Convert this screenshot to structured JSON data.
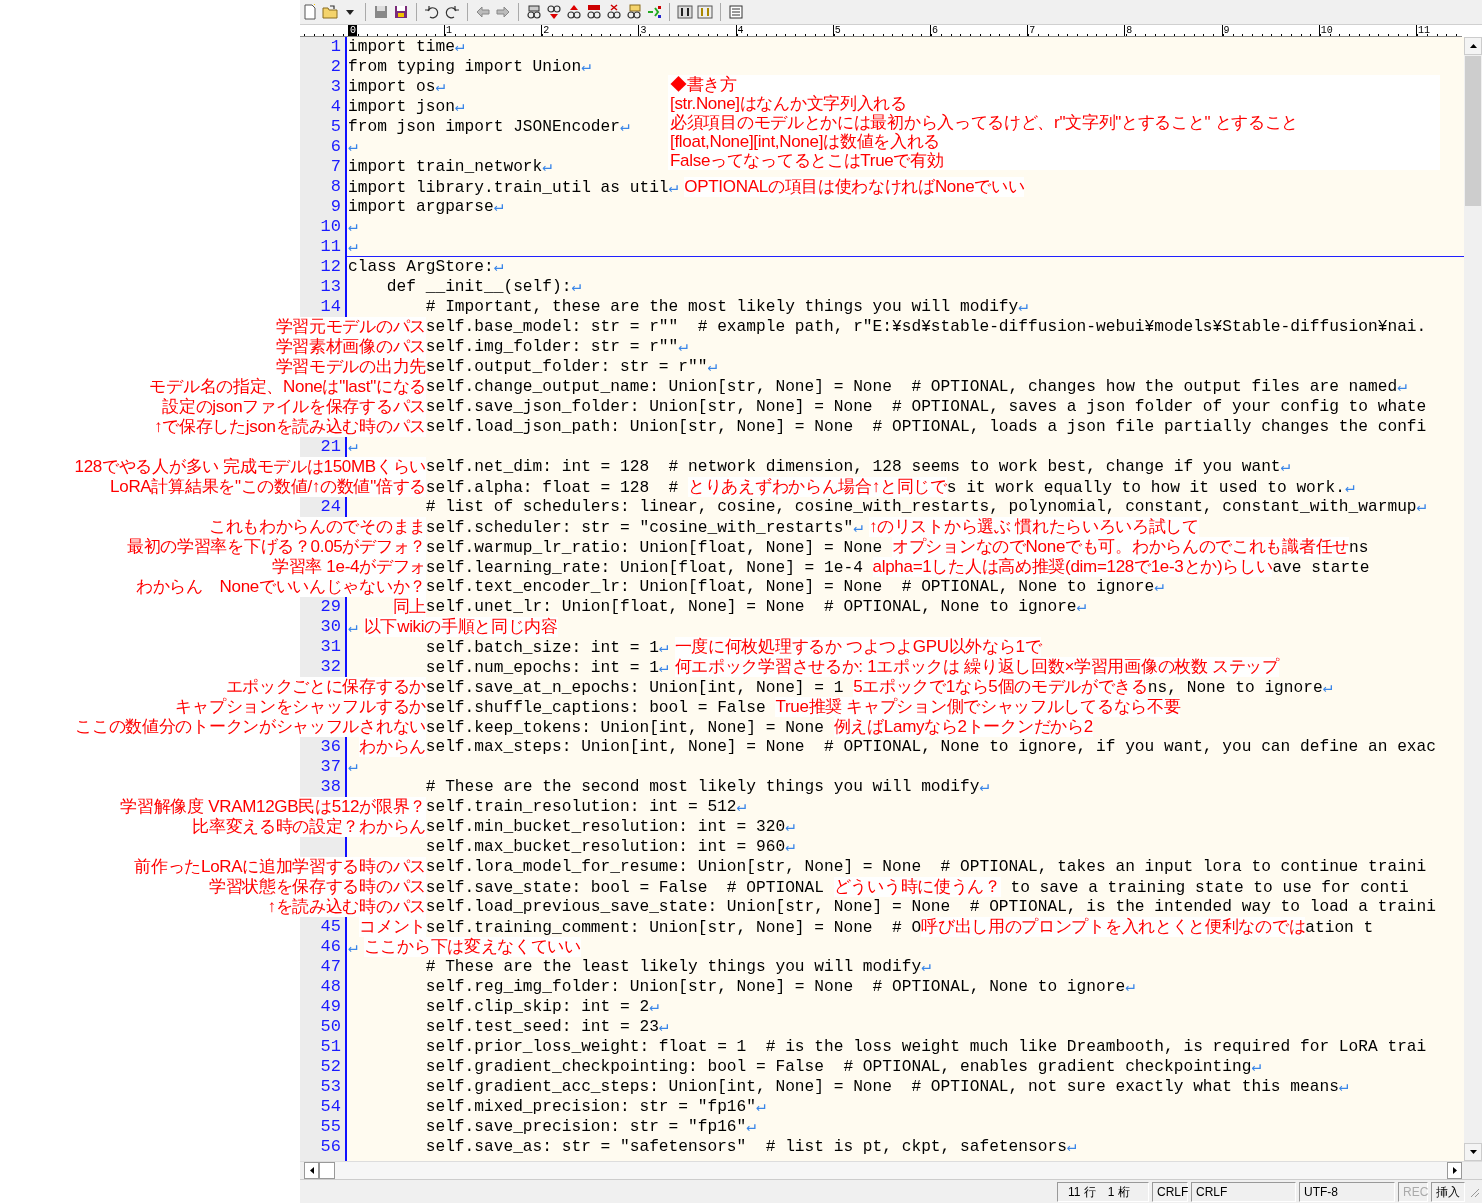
{
  "ruler": [
    {
      "label": "0",
      "current": true
    },
    {
      "label": "1",
      "current": false
    },
    {
      "label": "2",
      "current": false
    },
    {
      "label": "3",
      "current": false
    },
    {
      "label": "4",
      "current": false
    },
    {
      "label": "5",
      "current": false
    },
    {
      "label": "6",
      "current": false
    },
    {
      "label": "7",
      "current": false
    },
    {
      "label": "8",
      "current": false
    },
    {
      "label": "9",
      "current": false
    },
    {
      "label": "10",
      "current": false
    },
    {
      "label": "11",
      "current": false
    }
  ],
  "top_note": [
    "◆書き方",
    "[str.None]はなんか文字列入れる",
    "必須項目のモデルとかには最初から入ってるけど、r\"文字列\"とすること\" とすること",
    "[float,None][int,None]は数値を入れる",
    "FalseってなってるとこはTrueで有効"
  ],
  "rows": [
    {
      "num": "1",
      "current": false,
      "code": [
        {
          "kind": "code",
          "text": "import time"
        },
        {
          "kind": "eol",
          "text": "↵"
        }
      ]
    },
    {
      "num": "2",
      "current": false,
      "code": [
        {
          "kind": "code",
          "text": "from typing import Union"
        },
        {
          "kind": "eol",
          "text": "↵"
        }
      ]
    },
    {
      "num": "3",
      "current": false,
      "code": [
        {
          "kind": "code",
          "text": "import os"
        },
        {
          "kind": "eol",
          "text": "↵"
        }
      ]
    },
    {
      "num": "4",
      "current": false,
      "code": [
        {
          "kind": "code",
          "text": "import json"
        },
        {
          "kind": "eol",
          "text": "↵"
        }
      ]
    },
    {
      "num": "5",
      "current": false,
      "code": [
        {
          "kind": "code",
          "text": "from json import JSONEncoder"
        },
        {
          "kind": "eol",
          "text": "↵"
        }
      ]
    },
    {
      "num": "6",
      "current": false,
      "code": [
        {
          "kind": "eol",
          "text": "↵"
        }
      ]
    },
    {
      "num": "7",
      "current": false,
      "code": [
        {
          "kind": "code",
          "text": "import train_network"
        },
        {
          "kind": "eol",
          "text": "↵"
        }
      ]
    },
    {
      "num": "8",
      "current": false,
      "code": [
        {
          "kind": "code",
          "text": "import library.train_util as util"
        },
        {
          "kind": "eol",
          "text": "↵"
        },
        {
          "kind": "note",
          "text": "OPTIONALの項目は使わなければNoneでいい"
        }
      ]
    },
    {
      "num": "9",
      "current": false,
      "code": [
        {
          "kind": "code",
          "text": "import argparse"
        },
        {
          "kind": "eol",
          "text": "↵"
        }
      ]
    },
    {
      "num": "10",
      "current": false,
      "code": [
        {
          "kind": "eol",
          "text": "↵"
        }
      ]
    },
    {
      "num": "11",
      "current": true,
      "code": [
        {
          "kind": "eol",
          "text": "↵"
        }
      ]
    },
    {
      "num": "12",
      "current": false,
      "code": [
        {
          "kind": "code",
          "text": "class ArgStore:"
        },
        {
          "kind": "eol",
          "text": "↵"
        }
      ]
    },
    {
      "num": "13",
      "current": false,
      "code": [
        {
          "kind": "code",
          "text": "    def __init__(self):"
        },
        {
          "kind": "eol",
          "text": "↵"
        }
      ]
    },
    {
      "num": "14",
      "current": false,
      "code": [
        {
          "kind": "code",
          "text": "        # Important, these are the most likely things you will modify"
        },
        {
          "kind": "eol",
          "text": "↵"
        }
      ]
    },
    {
      "note_left": "学習元モデルのパス",
      "current": false,
      "code": [
        {
          "kind": "code",
          "text": "        self.base_model: str = r\"\"  # example path, r\"E:¥sd¥stable-diffusion-webui¥models¥Stable-diffusion¥nai."
        }
      ]
    },
    {
      "note_left": "学習素材画像のパス",
      "current": false,
      "code": [
        {
          "kind": "code",
          "text": "        self.img_folder: str = r\"\""
        },
        {
          "kind": "eol",
          "text": "↵"
        }
      ]
    },
    {
      "note_left": "学習モデルの出力先",
      "current": false,
      "code": [
        {
          "kind": "code",
          "text": "        self.output_folder: str = r\"\""
        },
        {
          "kind": "eol",
          "text": "↵"
        }
      ]
    },
    {
      "note_left": "モデル名の指定、Noneは\"last\"になる",
      "current": false,
      "code": [
        {
          "kind": "code",
          "text": "        self.change_output_name: Union[str, None] = None  # OPTIONAL, changes how the output files are named"
        },
        {
          "kind": "eol",
          "text": "↵"
        }
      ]
    },
    {
      "note_left": "設定のjsonファイルを保存するパス",
      "current": false,
      "code": [
        {
          "kind": "code",
          "text": "        self.save_json_folder: Union[str, None] = None  # OPTIONAL, saves a json folder of your config to whate"
        }
      ]
    },
    {
      "note_left": "↑で保存したjsonを読み込む時のパス",
      "current": false,
      "code": [
        {
          "kind": "code",
          "text": "        self.load_json_path: Union[str, None] = None  # OPTIONAL, loads a json file partially changes the confi"
        }
      ]
    },
    {
      "num": "21",
      "current": false,
      "code": [
        {
          "kind": "eol",
          "text": "↵"
        }
      ]
    },
    {
      "note_left": "128でやる人が多い 完成モデルは150MBくらい",
      "current": false,
      "code": [
        {
          "kind": "code",
          "text": "        self.net_dim: int = 128  # network dimension, 128 seems to work best, change if you want"
        },
        {
          "kind": "eol",
          "text": "↵"
        }
      ]
    },
    {
      "note_left": "LoRA計算結果を\"この数値/↑の数値\"倍する",
      "current": false,
      "code": [
        {
          "kind": "code",
          "text": "        self.alpha: float = 128  # "
        },
        {
          "kind": "note",
          "text": "とりあえずわからん場合↑と同じで"
        },
        {
          "kind": "code",
          "text": "s it work equally to how it used to work."
        },
        {
          "kind": "eol",
          "text": "↵"
        }
      ]
    },
    {
      "num": "24",
      "current": false,
      "code": [
        {
          "kind": "code",
          "text": "        # list of schedulers: linear, cosine, cosine_with_restarts, polynomial, constant, constant_with_warmup"
        },
        {
          "kind": "eol",
          "text": "↵"
        }
      ]
    },
    {
      "note_left": "これもわからんのでそのまま",
      "current": false,
      "code": [
        {
          "kind": "code",
          "text": "        self.scheduler: str = \"cosine_with_restarts\""
        },
        {
          "kind": "eol",
          "text": "↵"
        },
        {
          "kind": "note",
          "text": "↑のリストから選ぶ 慣れたらいろいろ試して"
        }
      ]
    },
    {
      "note_left": "最初の学習率を下げる？0.05がデフォ？",
      "current": false,
      "code": [
        {
          "kind": "code",
          "text": "        self.warmup_lr_ratio: Union[float, None] = None "
        },
        {
          "kind": "note",
          "text": "オプションなのでNoneでも可。わからんのでこれも識者任せ"
        },
        {
          "kind": "code",
          "text": "ns"
        }
      ]
    },
    {
      "note_left": "学習率 1e-4がデフォ",
      "current": false,
      "code": [
        {
          "kind": "code",
          "text": "        self.learning_rate: Union[float, None] = 1e-4 "
        },
        {
          "kind": "note",
          "text": "alpha=1した人は高め推奨(dim=128で1e-3とか)らしい"
        },
        {
          "kind": "code",
          "text": "ave starte"
        }
      ]
    },
    {
      "note_left": "わからん　Noneでいいんじゃないか？",
      "current": false,
      "code": [
        {
          "kind": "code",
          "text": "        self.text_encoder_lr: Union[float, None] = None  # OPTIONAL, None to ignore"
        },
        {
          "kind": "eol",
          "text": "↵"
        }
      ]
    },
    {
      "num": "29",
      "note_left": "同上",
      "current": false,
      "code": [
        {
          "kind": "code",
          "text": "        self.unet_lr: Union[float, None] = None  # OPTIONAL, None to ignore"
        },
        {
          "kind": "eol",
          "text": "↵"
        }
      ]
    },
    {
      "num": "30",
      "current": false,
      "code": [
        {
          "kind": "eol",
          "text": "↵"
        },
        {
          "kind": "note",
          "text": "以下wikiの手順と同じ内容"
        }
      ]
    },
    {
      "num": "31",
      "current": false,
      "code": [
        {
          "kind": "code",
          "text": "        self.batch_size: int = 1"
        },
        {
          "kind": "eol",
          "text": "↵"
        },
        {
          "kind": "note",
          "text": "一度に何枚処理するか つよつよGPU以外なら1で"
        }
      ]
    },
    {
      "num": "32",
      "current": false,
      "code": [
        {
          "kind": "code",
          "text": "        self.num_epochs: int = 1"
        },
        {
          "kind": "eol",
          "text": "↵"
        },
        {
          "kind": "note",
          "text": "何エポック学習させるか: 1エポックは 繰り返し回数×学習用画像の枚数 ステップ"
        }
      ]
    },
    {
      "note_left": "エポックごとに保存するか",
      "current": false,
      "code": [
        {
          "kind": "code",
          "text": "        self.save_at_n_epochs: Union[int, None] = 1 "
        },
        {
          "kind": "note",
          "text": "5エポックで1なら5個のモデルができる"
        },
        {
          "kind": "code",
          "text": "ns, None to ignore"
        },
        {
          "kind": "eol",
          "text": "↵"
        }
      ]
    },
    {
      "note_left": "キャプションをシャッフルするか",
      "current": false,
      "code": [
        {
          "kind": "code",
          "text": "        self.shuffle_captions: bool = False "
        },
        {
          "kind": "note",
          "text": "True推奨 キャプション側でシャッフルしてるなら不要"
        }
      ]
    },
    {
      "note_left": "ここの数値分のトークンがシャッフルされない",
      "current": false,
      "code": [
        {
          "kind": "code",
          "text": "        self.keep_tokens: Union[int, None] = None "
        },
        {
          "kind": "note",
          "text": "例えばLamyなら2トークンだから2"
        }
      ]
    },
    {
      "num": "36",
      "note_left": "わからん",
      "current": false,
      "code": [
        {
          "kind": "code",
          "text": "        self.max_steps: Union[int, None] = None  # OPTIONAL, None to ignore, if you want, you can define an exac"
        }
      ]
    },
    {
      "num": "37",
      "current": false,
      "code": [
        {
          "kind": "eol",
          "text": "↵"
        }
      ]
    },
    {
      "num": "38",
      "current": false,
      "code": [
        {
          "kind": "code",
          "text": "        # These are the second most likely things you will modify"
        },
        {
          "kind": "eol",
          "text": "↵"
        }
      ]
    },
    {
      "note_left": "学習解像度 VRAM12GB民は512が限界？",
      "current": false,
      "code": [
        {
          "kind": "code",
          "text": "        self.train_resolution: int = 512"
        },
        {
          "kind": "eol",
          "text": "↵"
        }
      ]
    },
    {
      "note_left": "比率変える時の設定？わからん",
      "current": false,
      "code": [
        {
          "kind": "code",
          "text": "        self.min_bucket_resolution: int = 320"
        },
        {
          "kind": "eol",
          "text": "↵"
        }
      ]
    },
    {
      "current": false,
      "code": [
        {
          "kind": "code",
          "text": "        self.max_bucket_resolution: int = 960"
        },
        {
          "kind": "eol",
          "text": "↵"
        }
      ]
    },
    {
      "note_left": "前作ったLoRAに追加学習する時のパス",
      "current": false,
      "code": [
        {
          "kind": "code",
          "text": "        self.lora_model_for_resume: Union[str, None] = None  # OPTIONAL, takes an input lora to continue traini"
        }
      ]
    },
    {
      "note_left": "学習状態を保存する時のパス",
      "current": false,
      "code": [
        {
          "kind": "code",
          "text": "        self.save_state: bool = False  # OPTIONAL "
        },
        {
          "kind": "note",
          "text": "どういう時に使うん？"
        },
        {
          "kind": "code",
          "text": " to save a training state to use for conti"
        }
      ]
    },
    {
      "note_left": "↑を読み込む時のパス",
      "current": false,
      "code": [
        {
          "kind": "code",
          "text": "        self.load_previous_save_state: Union[str, None] = None  # OPTIONAL, is the intended way to load a traini"
        }
      ]
    },
    {
      "num": "45",
      "note_left": "コメント",
      "current": false,
      "code": [
        {
          "kind": "code",
          "text": "        self.training_comment: Union[str, None] = None  # O"
        },
        {
          "kind": "note",
          "text": "呼び出し用のプロンプトを入れとくと便利なのでは"
        },
        {
          "kind": "code",
          "text": "ation t"
        }
      ]
    },
    {
      "num": "46",
      "current": false,
      "code": [
        {
          "kind": "eol",
          "text": "↵"
        },
        {
          "kind": "note",
          "text": "ここから下は変えなくていい"
        }
      ]
    },
    {
      "num": "47",
      "current": false,
      "code": [
        {
          "kind": "code",
          "text": "        # These are the least likely things you will modify"
        },
        {
          "kind": "eol",
          "text": "↵"
        }
      ]
    },
    {
      "num": "48",
      "current": false,
      "code": [
        {
          "kind": "code",
          "text": "        self.reg_img_folder: Union[str, None] = None  # OPTIONAL, None to ignore"
        },
        {
          "kind": "eol",
          "text": "↵"
        }
      ]
    },
    {
      "num": "49",
      "current": false,
      "code": [
        {
          "kind": "code",
          "text": "        self.clip_skip: int = 2"
        },
        {
          "kind": "eol",
          "text": "↵"
        }
      ]
    },
    {
      "num": "50",
      "current": false,
      "code": [
        {
          "kind": "code",
          "text": "        self.test_seed: int = 23"
        },
        {
          "kind": "eol",
          "text": "↵"
        }
      ]
    },
    {
      "num": "51",
      "current": false,
      "code": [
        {
          "kind": "code",
          "text": "        self.prior_loss_weight: float = 1  # is the loss weight much like Dreambooth, is required for LoRA trai"
        }
      ]
    },
    {
      "num": "52",
      "current": false,
      "code": [
        {
          "kind": "code",
          "text": "        self.gradient_checkpointing: bool = False  # OPTIONAL, enables gradient checkpointing"
        },
        {
          "kind": "eol",
          "text": "↵"
        }
      ]
    },
    {
      "num": "53",
      "current": false,
      "code": [
        {
          "kind": "code",
          "text": "        self.gradient_acc_steps: Union[int, None] = None  # OPTIONAL, not sure exactly what this means"
        },
        {
          "kind": "eol",
          "text": "↵"
        }
      ]
    },
    {
      "num": "54",
      "current": false,
      "code": [
        {
          "kind": "code",
          "text": "        self.mixed_precision: str = \"fp16\""
        },
        {
          "kind": "eol",
          "text": "↵"
        }
      ]
    },
    {
      "num": "55",
      "current": false,
      "code": [
        {
          "kind": "code",
          "text": "        self.save_precision: str = \"fp16\""
        },
        {
          "kind": "eol",
          "text": "↵"
        }
      ]
    },
    {
      "num": "56",
      "current": false,
      "code": [
        {
          "kind": "code",
          "text": "        self.save_as: str = \"safetensors\"  # list is pt, ckpt, safetensors"
        },
        {
          "kind": "eol",
          "text": "↵"
        }
      ]
    }
  ],
  "status_bar": [
    {
      "kind": "pos",
      "label": "11 行　1 桁",
      "on": true
    },
    {
      "kind": "eol",
      "label": "CRLF",
      "on": true
    },
    {
      "kind": "eol2",
      "label": "CRLF",
      "on": true
    },
    {
      "kind": "enc",
      "label": "UTF-8",
      "on": true
    },
    {
      "kind": "rec",
      "label": "REC",
      "on": false
    },
    {
      "kind": "mode",
      "label": "挿入",
      "on": true
    }
  ]
}
